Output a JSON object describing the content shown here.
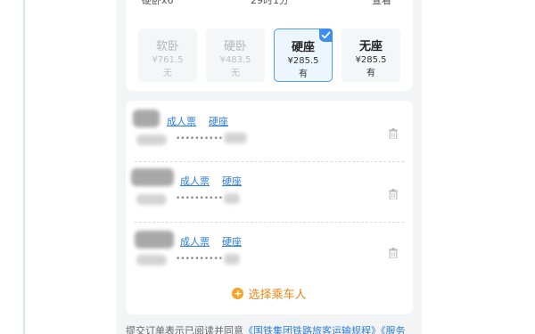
{
  "header": {
    "left_text": "硬卧x6",
    "duration": "29时1分",
    "right_text": "查看"
  },
  "seats": [
    {
      "name": "软卧",
      "price": "¥761.5",
      "availability": "无",
      "selected": false
    },
    {
      "name": "硬卧",
      "price": "¥483.5",
      "availability": "无",
      "selected": false
    },
    {
      "name": "硬座",
      "price": "¥285.5",
      "availability": "有",
      "selected": true
    },
    {
      "name": "无座",
      "price": "¥285.5",
      "availability": "有",
      "selected": false
    }
  ],
  "passengers": [
    {
      "ticket_type": "成人票",
      "seat": "硬座",
      "id_masked": "••••••••••"
    },
    {
      "ticket_type": "成人票",
      "seat": "硬座",
      "id_masked": "••••••••••"
    },
    {
      "ticket_type": "成人票",
      "seat": "硬座",
      "id_masked": "••••••••••"
    }
  ],
  "select_passenger": {
    "label": "选择乘车人",
    "icon": "plus-circle-icon"
  },
  "footer": {
    "text": "提交订单表示已阅读并同意",
    "link": "《国铁集团铁路旅客运输规程》《服务"
  },
  "colors": {
    "accent_blue": "#3d8ef0",
    "link_blue": "#2f7ed8",
    "orange": "#e8871a",
    "background": "#f3f4f6"
  }
}
